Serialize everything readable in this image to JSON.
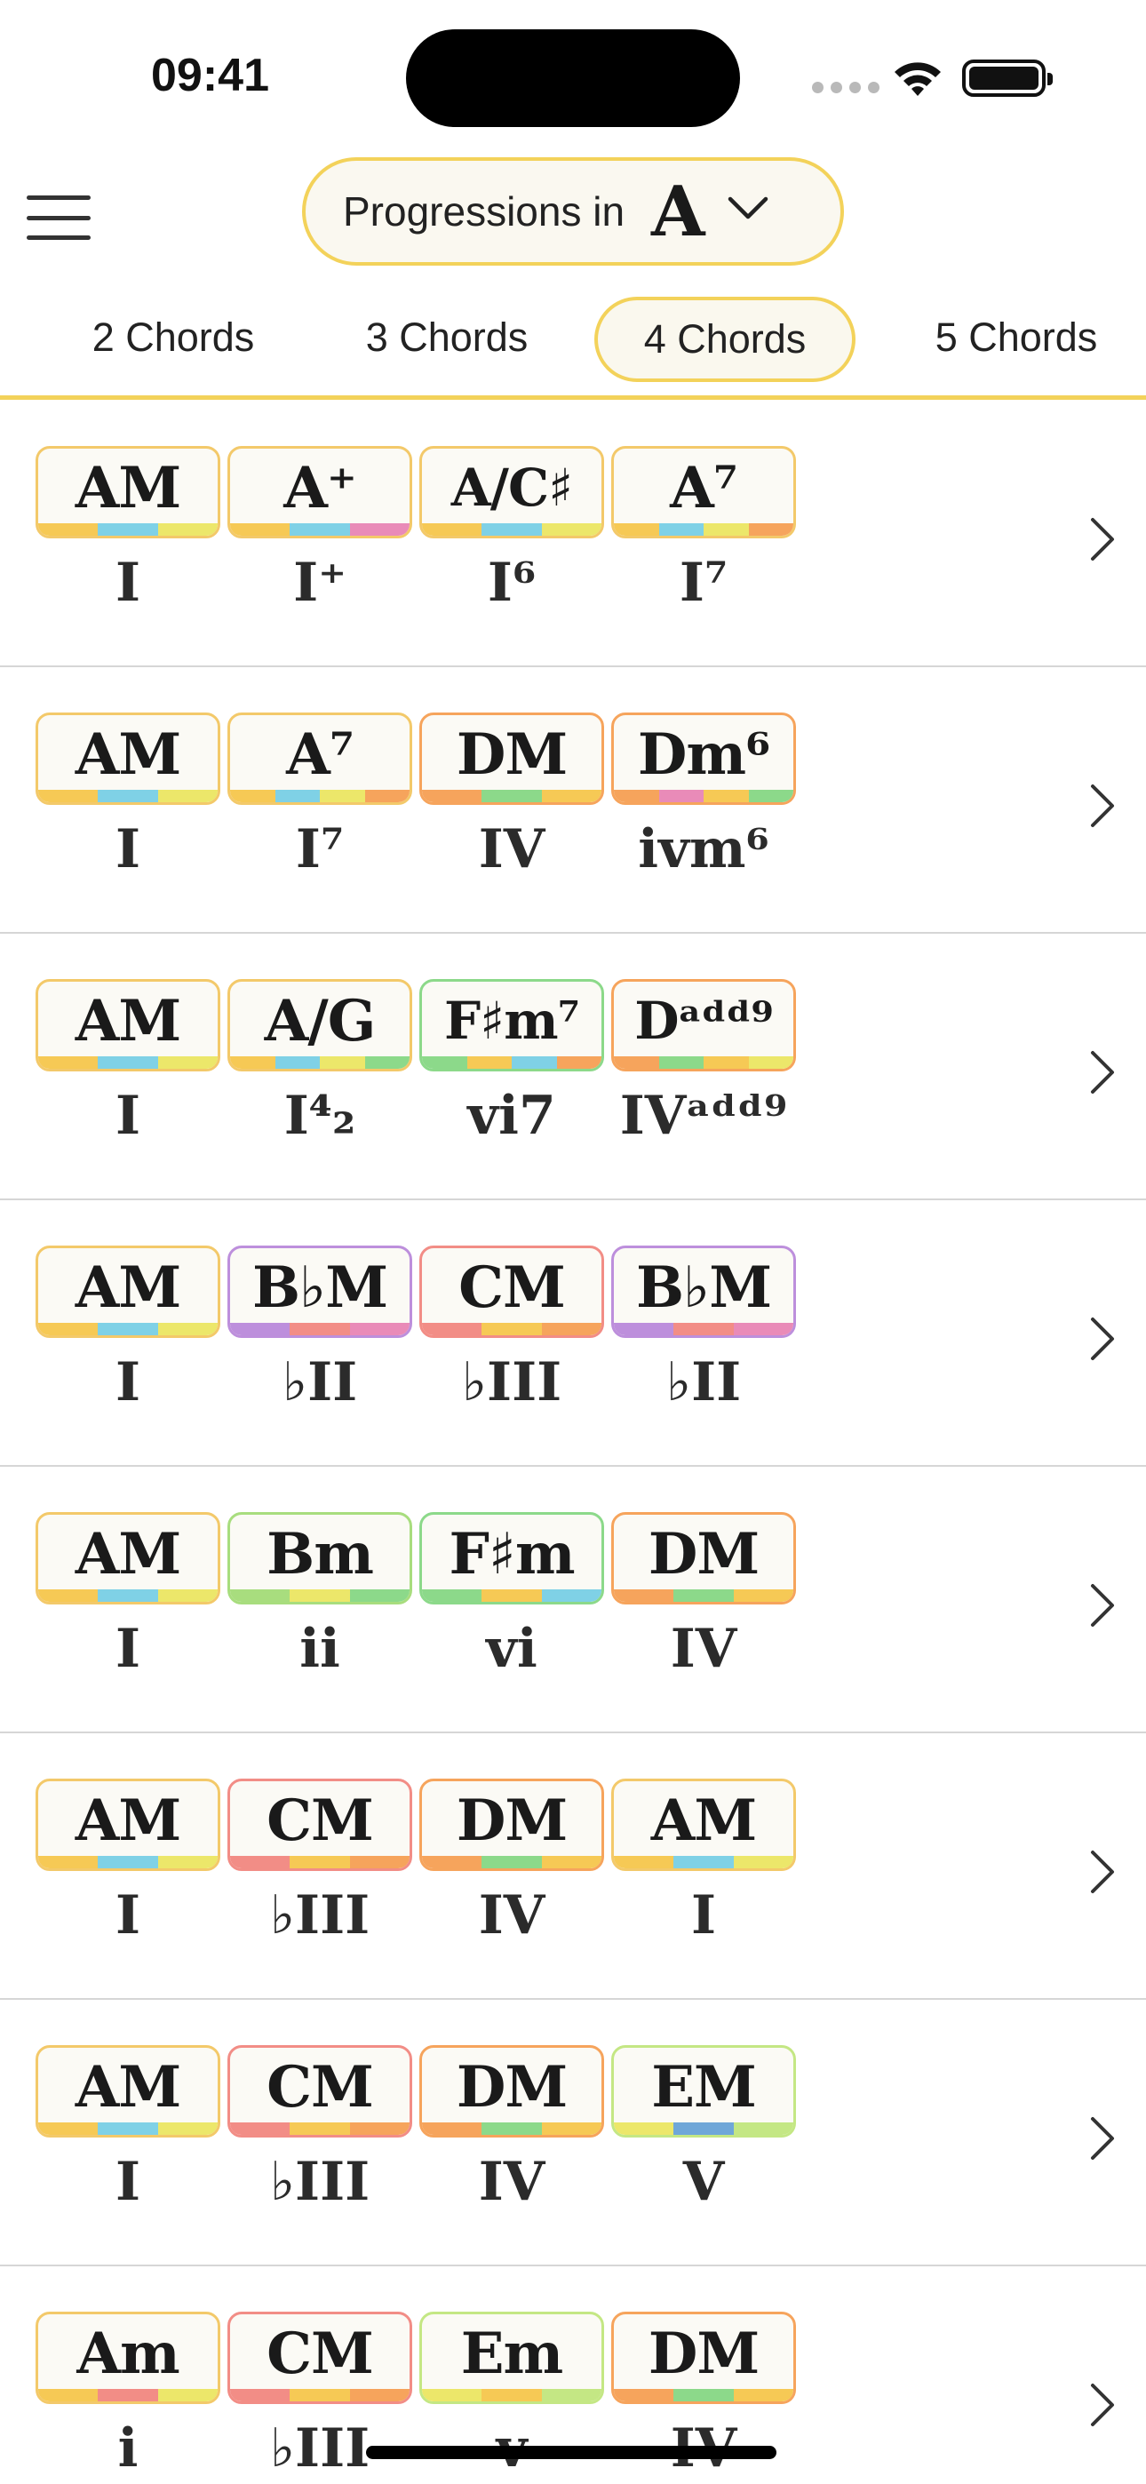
{
  "status_bar": {
    "time": "09:41"
  },
  "header": {
    "selector_label": "Progressions in",
    "key": "A"
  },
  "tabs": [
    {
      "label": "2 Chords",
      "active": false
    },
    {
      "label": "3 Chords",
      "active": false
    },
    {
      "label": "4 Chords",
      "active": true
    },
    {
      "label": "5 Chords",
      "active": false
    }
  ],
  "colors": {
    "accent": "#f3d25a",
    "tonic": "#f3c96a",
    "blue": "#7fd1e6",
    "yellow": "#ece76a",
    "pink": "#e98bb8",
    "orange": "#f6a45c",
    "green": "#8cd98a",
    "purple": "#bd8fdc",
    "red": "#f28d86",
    "lime": "#c4e784"
  },
  "progressions": [
    {
      "chords": [
        {
          "name": "AM",
          "numeral": "I",
          "border": "#f3c96a",
          "stripe": [
            "#f6c955",
            "#7fd1e6",
            "#ece76a"
          ]
        },
        {
          "name": "A⁺",
          "numeral": "I⁺",
          "border": "#f3c96a",
          "stripe": [
            "#f6c955",
            "#7fd1e6",
            "#e98bb8"
          ]
        },
        {
          "name": "A/C♯",
          "numeral": "I⁶",
          "border": "#f3c96a",
          "stripe": [
            "#f6c955",
            "#7fd1e6",
            "#ece76a"
          ]
        },
        {
          "name": "A⁷",
          "numeral": "I⁷",
          "border": "#f3c96a",
          "stripe": [
            "#f6c955",
            "#7fd1e6",
            "#ece76a",
            "#f6a45c"
          ]
        }
      ]
    },
    {
      "chords": [
        {
          "name": "AM",
          "numeral": "I",
          "border": "#f3c96a",
          "stripe": [
            "#f6c955",
            "#7fd1e6",
            "#ece76a"
          ]
        },
        {
          "name": "A⁷",
          "numeral": "I⁷",
          "border": "#f3c96a",
          "stripe": [
            "#f6c955",
            "#7fd1e6",
            "#ece76a",
            "#f6a45c"
          ]
        },
        {
          "name": "DM",
          "numeral": "IV",
          "border": "#f6a45c",
          "stripe": [
            "#f6a45c",
            "#8cd98a",
            "#f6c955"
          ]
        },
        {
          "name": "Dm⁶",
          "numeral": "ivm⁶",
          "border": "#f6a45c",
          "stripe": [
            "#f6a45c",
            "#e98bb8",
            "#f6c955",
            "#8cd98a"
          ]
        }
      ]
    },
    {
      "chords": [
        {
          "name": "AM",
          "numeral": "I",
          "border": "#f3c96a",
          "stripe": [
            "#f6c955",
            "#7fd1e6",
            "#ece76a"
          ]
        },
        {
          "name": "A/G",
          "numeral": "I⁴₂",
          "border": "#f3c96a",
          "stripe": [
            "#f6c955",
            "#7fd1e6",
            "#ece76a",
            "#8cd98a"
          ]
        },
        {
          "name": "F♯m⁷",
          "numeral": "vi7",
          "border": "#8cd98a",
          "stripe": [
            "#8cd98a",
            "#f6c955",
            "#7fd1e6",
            "#f6a45c"
          ]
        },
        {
          "name": "Dᵃᵈᵈ⁹",
          "numeral": "IVᵃᵈᵈ⁹",
          "border": "#f6a45c",
          "stripe": [
            "#f6a45c",
            "#8cd98a",
            "#f6c955",
            "#ece76a"
          ]
        }
      ]
    },
    {
      "chords": [
        {
          "name": "AM",
          "numeral": "I",
          "border": "#f3c96a",
          "stripe": [
            "#f6c955",
            "#7fd1e6",
            "#ece76a"
          ]
        },
        {
          "name": "B♭M",
          "numeral": "♭II",
          "border": "#bd8fdc",
          "stripe": [
            "#bd8fdc",
            "#f28d86",
            "#e98bb8"
          ]
        },
        {
          "name": "CM",
          "numeral": "♭III",
          "border": "#f28d86",
          "stripe": [
            "#f28d86",
            "#f6c955",
            "#f6a45c"
          ]
        },
        {
          "name": "B♭M",
          "numeral": "♭II",
          "border": "#bd8fdc",
          "stripe": [
            "#bd8fdc",
            "#f28d86",
            "#e98bb8"
          ]
        }
      ]
    },
    {
      "chords": [
        {
          "name": "AM",
          "numeral": "I",
          "border": "#f3c96a",
          "stripe": [
            "#f6c955",
            "#7fd1e6",
            "#ece76a"
          ]
        },
        {
          "name": "Bm",
          "numeral": "ii",
          "border": "#a8dd7e",
          "stripe": [
            "#a8dd7e",
            "#ece76a",
            "#8cd98a"
          ]
        },
        {
          "name": "F♯m",
          "numeral": "vi",
          "border": "#8cd98a",
          "stripe": [
            "#8cd98a",
            "#f6c955",
            "#7fd1e6"
          ]
        },
        {
          "name": "DM",
          "numeral": "IV",
          "border": "#f6a45c",
          "stripe": [
            "#f6a45c",
            "#8cd98a",
            "#f6c955"
          ]
        }
      ]
    },
    {
      "chords": [
        {
          "name": "AM",
          "numeral": "I",
          "border": "#f3c96a",
          "stripe": [
            "#f6c955",
            "#7fd1e6",
            "#ece76a"
          ]
        },
        {
          "name": "CM",
          "numeral": "♭III",
          "border": "#f28d86",
          "stripe": [
            "#f28d86",
            "#f6c955",
            "#f6a45c"
          ]
        },
        {
          "name": "DM",
          "numeral": "IV",
          "border": "#f6a45c",
          "stripe": [
            "#f6a45c",
            "#8cd98a",
            "#f6c955"
          ]
        },
        {
          "name": "AM",
          "numeral": "I",
          "border": "#f3c96a",
          "stripe": [
            "#f6c955",
            "#7fd1e6",
            "#ece76a"
          ]
        }
      ]
    },
    {
      "chords": [
        {
          "name": "AM",
          "numeral": "I",
          "border": "#f3c96a",
          "stripe": [
            "#f6c955",
            "#7fd1e6",
            "#ece76a"
          ]
        },
        {
          "name": "CM",
          "numeral": "♭III",
          "border": "#f28d86",
          "stripe": [
            "#f28d86",
            "#f6c955",
            "#f6a45c"
          ]
        },
        {
          "name": "DM",
          "numeral": "IV",
          "border": "#f6a45c",
          "stripe": [
            "#f6a45c",
            "#8cd98a",
            "#f6c955"
          ]
        },
        {
          "name": "EM",
          "numeral": "V",
          "border": "#c4e784",
          "stripe": [
            "#ece76a",
            "#6fa7d8",
            "#c4e784"
          ]
        }
      ]
    },
    {
      "chords": [
        {
          "name": "Am",
          "numeral": "i",
          "border": "#f3c96a",
          "stripe": [
            "#f6c955",
            "#f28d86",
            "#ece76a"
          ]
        },
        {
          "name": "CM",
          "numeral": "♭III",
          "border": "#f28d86",
          "stripe": [
            "#f28d86",
            "#f6c955",
            "#f6a45c"
          ]
        },
        {
          "name": "Em",
          "numeral": "v",
          "border": "#c4e784",
          "stripe": [
            "#ece76a",
            "#f6c955",
            "#c4e784"
          ]
        },
        {
          "name": "DM",
          "numeral": "IV",
          "border": "#f6a45c",
          "stripe": [
            "#f6a45c",
            "#8cd98a",
            "#f6c955"
          ]
        }
      ]
    }
  ]
}
